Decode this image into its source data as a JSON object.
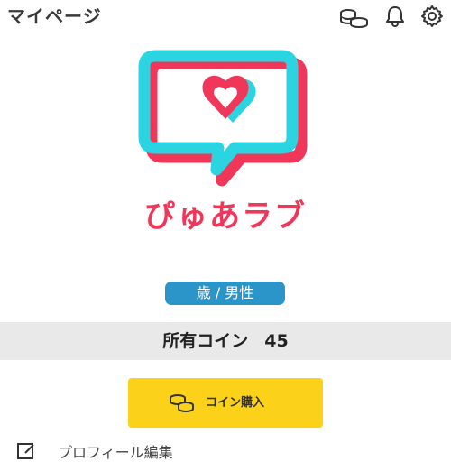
{
  "header": {
    "title": "マイページ",
    "icons": [
      "coins-icon",
      "bell-icon",
      "gear-icon"
    ]
  },
  "logo": {
    "brand_text": "ぴゅあラブ",
    "colors": {
      "cyan": "#2ad4e0",
      "pink": "#f0375a"
    }
  },
  "profile": {
    "badge_text": "歳 / 男性"
  },
  "coins": {
    "label": "所有コイン",
    "count": "45"
  },
  "buy_button": {
    "label": "コイン購入",
    "color": "#fbd11a"
  },
  "menu": {
    "next_item_label": "プロフィール編集"
  }
}
